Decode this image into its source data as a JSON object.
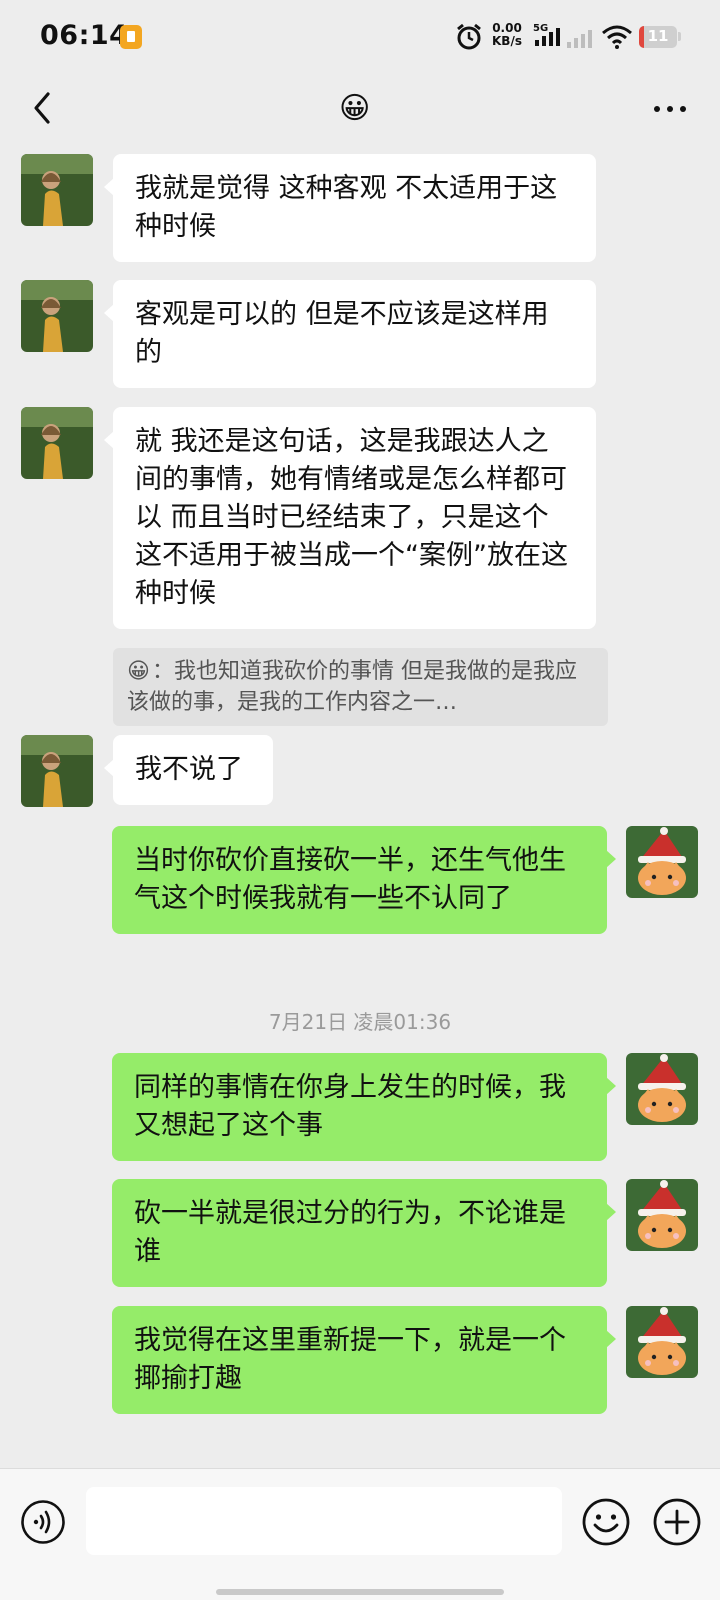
{
  "status_bar": {
    "time": "06:14",
    "net_speed_value": "0.00",
    "net_speed_unit": "KB/s",
    "network_type": "5G",
    "battery_level": "11"
  },
  "header": {
    "title": "😀"
  },
  "messages": [
    {
      "side": "in",
      "text": "我就是觉得 这种客观 不太适用于这种时候"
    },
    {
      "side": "in",
      "text": "客观是可以的 但是不应该是这样用的"
    },
    {
      "side": "in",
      "text": "就 我还是这句话，这是我跟达人之间的事情，她有情绪或是怎么样都可以 而且当时已经结束了，只是这个这不适用于被当成一个“案例”放在这种时候"
    },
    {
      "side": "in",
      "text": "我不说了"
    },
    {
      "side": "out",
      "text": "当时你砍价直接砍一半，还生气他生气这个时候我就有一些不认同了"
    },
    {
      "side": "out",
      "text": "同样的事情在你身上发生的时候，我又想起了这个事"
    },
    {
      "side": "out",
      "text": "砍一半就是很过分的行为，不论谁是谁"
    },
    {
      "side": "out",
      "text": "我觉得在这里重新提一下，就是一个揶揄打趣"
    }
  ],
  "quote": {
    "sender": "😀",
    "text": "我也知道我砍价的事情 但是我做的是我应该做的事，是我的工作内容之一…"
  },
  "timestamp": "7月21日 凌晨01:36",
  "input": {
    "value": "",
    "placeholder": ""
  },
  "colors": {
    "background": "#ededed",
    "incoming_bubble": "#ffffff",
    "outgoing_bubble": "#95ec69",
    "quote_background": "#e1e1e1"
  },
  "icons": [
    "back-icon",
    "more-icon",
    "voice-icon",
    "emoji-icon",
    "plus-icon"
  ]
}
